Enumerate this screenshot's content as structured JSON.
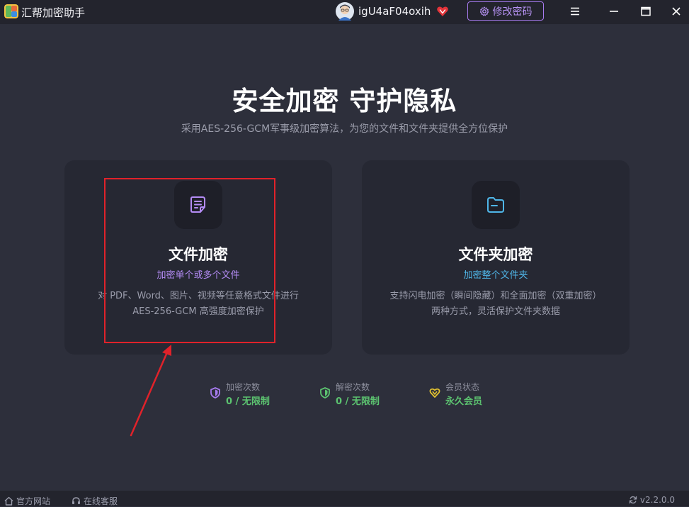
{
  "app": {
    "title": "汇帮加密助手"
  },
  "header": {
    "username": "igU4aF04oxih",
    "change_password_label": "修改密码",
    "accent_color": "#a77bf0"
  },
  "hero": {
    "title": "安全加密 守护隐私",
    "subtitle": "采用AES-256-GCM军事级加密算法，为您的文件和文件夹提供全方位保护"
  },
  "cards": [
    {
      "icon": "file-icon",
      "title": "文件加密",
      "subtitle": "加密单个或多个文件",
      "subtitle_color": "#b48cf5",
      "desc_line1": "对 PDF、Word、图片、视频等任意格式文件进行",
      "desc_line2": "AES-256-GCM 高强度加密保护"
    },
    {
      "icon": "folder-icon",
      "title": "文件夹加密",
      "subtitle": "加密整个文件夹",
      "subtitle_color": "#4fb6e8",
      "desc_line1": "支持闪电加密（瞬间隐藏）和全面加密（双重加密）",
      "desc_line2": "两种方式，灵活保护文件夹数据"
    }
  ],
  "stats": [
    {
      "icon": "shield-icon",
      "label": "加密次数",
      "value": "0 / 无限制",
      "icon_color": "#a77bf0"
    },
    {
      "icon": "shield-check-icon",
      "label": "解密次数",
      "value": "0 / 无限制",
      "icon_color": "#5cc370"
    },
    {
      "icon": "heart-icon",
      "label": "会员状态",
      "value": "永久会员",
      "icon_color": "#e6c530"
    }
  ],
  "footer": {
    "website_label": "官方网站",
    "support_label": "在线客服",
    "version": "v2.2.0.0"
  }
}
